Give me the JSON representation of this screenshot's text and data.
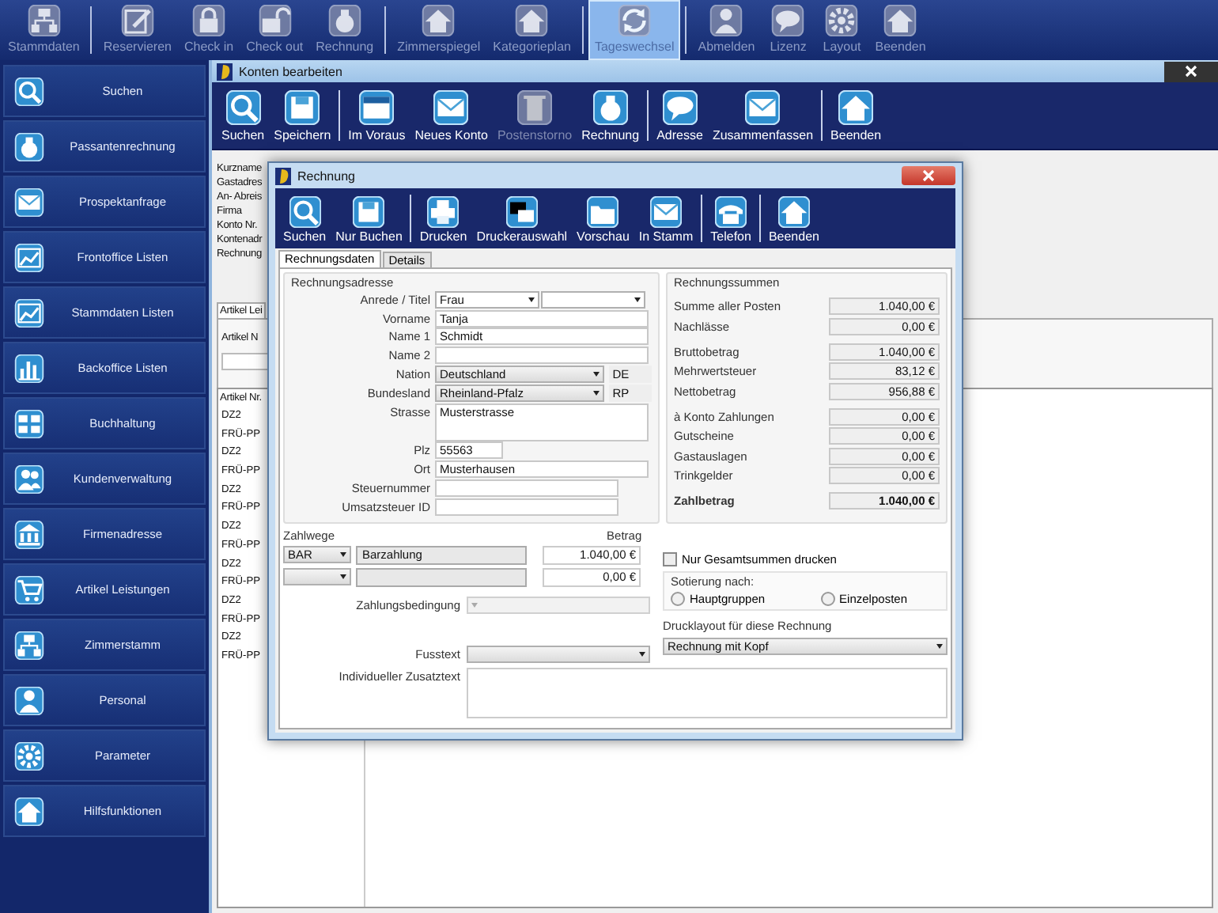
{
  "top_toolbar": {
    "items": [
      {
        "label": "Stammdaten",
        "selected": false,
        "separator_before": false
      },
      {
        "label": "Reservieren",
        "selected": false,
        "separator_before": true
      },
      {
        "label": "Check in",
        "selected": false,
        "separator_before": false
      },
      {
        "label": "Check out",
        "selected": false,
        "separator_before": false
      },
      {
        "label": "Rechnung",
        "selected": false,
        "separator_before": false
      },
      {
        "label": "Zimmerspiegel",
        "selected": false,
        "separator_before": true
      },
      {
        "label": "Kategorieplan",
        "selected": false,
        "separator_before": false
      },
      {
        "label": "Tageswechsel",
        "selected": true,
        "separator_before": true
      },
      {
        "label": "Abmelden",
        "selected": false,
        "separator_before": true
      },
      {
        "label": "Lizenz",
        "selected": false,
        "separator_before": false
      },
      {
        "label": "Layout",
        "selected": false,
        "separator_before": false
      },
      {
        "label": "Beenden",
        "selected": false,
        "separator_before": false
      }
    ]
  },
  "sidebar": {
    "items": [
      "Suchen",
      "Passantenrechnung",
      "Prospektanfrage",
      "Frontoffice Listen",
      "Stammdaten Listen",
      "Backoffice Listen",
      "Buchhaltung",
      "Kundenverwaltung",
      "Firmenadresse",
      "Artikel Leistungen",
      "Zimmerstamm",
      "Personal",
      "Parameter",
      "Hilfsfunktionen"
    ]
  },
  "background_window": {
    "title": "Konten bearbeiten",
    "toolbar": [
      {
        "label": "Suchen",
        "disabled": false,
        "separator_before": false
      },
      {
        "label": "Speichern",
        "disabled": false,
        "separator_before": false
      },
      {
        "label": "Im Voraus",
        "disabled": false,
        "separator_before": true
      },
      {
        "label": "Neues Konto",
        "disabled": false,
        "separator_before": false
      },
      {
        "label": "Postenstorno",
        "disabled": true,
        "separator_before": false
      },
      {
        "label": "Rechnung",
        "disabled": false,
        "separator_before": false
      },
      {
        "label": "Adresse",
        "disabled": false,
        "separator_before": true
      },
      {
        "label": "Zusammenfassen",
        "disabled": false,
        "separator_before": false
      },
      {
        "label": "Beenden",
        "disabled": false,
        "separator_before": true
      }
    ],
    "form_labels": [
      "Kurzname",
      "Gastadres",
      "An- Abreis",
      "Firma",
      "Konto Nr.",
      "Kontenadr",
      "Rechnung"
    ],
    "tab": "Artikel Lei",
    "article_label": "Artikel N",
    "list": {
      "column": "Artikel Nr.",
      "rows": [
        "DZ2",
        "FRÜ-PP",
        "DZ2",
        "FRÜ-PP",
        "DZ2",
        "FRÜ-PP",
        "DZ2",
        "FRÜ-PP",
        "DZ2",
        "FRÜ-PP",
        "DZ2",
        "FRÜ-PP",
        "DZ2",
        "FRÜ-PP"
      ]
    }
  },
  "dialog": {
    "title": "Rechnung",
    "toolbar": [
      {
        "label": "Suchen",
        "separator_before": false
      },
      {
        "label": "Nur Buchen",
        "separator_before": false
      },
      {
        "label": "Drucken",
        "separator_before": true
      },
      {
        "label": "Druckerauswahl",
        "separator_before": false
      },
      {
        "label": "Vorschau",
        "separator_before": false
      },
      {
        "label": "In Stamm",
        "separator_before": false
      },
      {
        "label": "Telefon",
        "separator_before": true
      },
      {
        "label": "Beenden",
        "separator_before": true
      }
    ],
    "tabs": [
      {
        "label": "Rechnungsdaten",
        "selected": true
      },
      {
        "label": "Details",
        "selected": false
      }
    ],
    "address": {
      "title": "Rechnungsadresse",
      "fields": [
        {
          "label": "Anrede / Titel",
          "kind": "dropdown_pair",
          "value": "Frau"
        },
        {
          "label": "Vorname",
          "kind": "text",
          "value": "Tanja"
        },
        {
          "label": "Name 1",
          "kind": "text",
          "value": "Schmidt"
        },
        {
          "label": "Name 2",
          "kind": "text"
        },
        {
          "label": "Nation",
          "kind": "dropdown_code",
          "value": "Deutschland",
          "code": "DE"
        },
        {
          "label": "Bundesland",
          "kind": "dropdown_code",
          "value": "Rheinland-Pfalz",
          "code": "RP"
        },
        {
          "label": "Strasse",
          "kind": "textarea",
          "value": "Musterstrasse"
        },
        {
          "label": "Plz",
          "kind": "short",
          "value": "55563"
        },
        {
          "label": "Ort",
          "kind": "text",
          "value": "Musterhausen"
        },
        {
          "label": "Steuernummer",
          "kind": "medium"
        },
        {
          "label": "Umsatzsteuer ID",
          "kind": "medium"
        }
      ]
    },
    "totals": {
      "title": "Rechnungssummen",
      "groups": [
        {
          "rows": [
            {
              "label": "Summe aller Posten",
              "value": "1.040,00 €",
              "bold": false
            },
            {
              "label": "Nachlässe",
              "value": "0,00 €",
              "bold": false
            }
          ]
        },
        {
          "rows": [
            {
              "label": "Bruttobetrag",
              "value": "1.040,00 €",
              "bold": false
            },
            {
              "label": "Mehrwertsteuer",
              "value": "83,12 €",
              "bold": false
            },
            {
              "label": "Nettobetrag",
              "value": "956,88 €",
              "bold": false
            }
          ]
        },
        {
          "rows": [
            {
              "label": "à Konto Zahlungen",
              "value": "0,00 €",
              "bold": false
            },
            {
              "label": "Gutscheine",
              "value": "0,00 €",
              "bold": false
            },
            {
              "label": "Gastauslagen",
              "value": "0,00 €",
              "bold": false
            },
            {
              "label": "Trinkgelder",
              "value": "0,00 €",
              "bold": false
            }
          ]
        },
        {
          "rows": [
            {
              "label": "Zahlbetrag",
              "value": "1.040,00 €",
              "bold": true
            }
          ]
        }
      ]
    },
    "payment": {
      "title": "Zahlwege",
      "amount_header": "Betrag",
      "rows": [
        {
          "method": "BAR",
          "description": "Barzahlung",
          "amount": "1.040,00 €"
        },
        {
          "amount": "0,00 €"
        }
      ],
      "terms_label": "Zahlungsbedingung",
      "terms_disabled": true
    },
    "totals_only": {
      "label": "Nur Gesamtsummen drucken",
      "checked": false
    },
    "sorting": {
      "title": "Sotierung nach:",
      "options": [
        {
          "label": "Hauptgruppen",
          "selected": false
        },
        {
          "label": "Einzelposten",
          "selected": false
        }
      ]
    },
    "layout": {
      "label": "Drucklayout für diese Rechnung",
      "value": "Rechnung mit Kopf"
    },
    "footer_label": "Fusstext",
    "extra_text_label": "Individueller Zusatztext"
  }
}
